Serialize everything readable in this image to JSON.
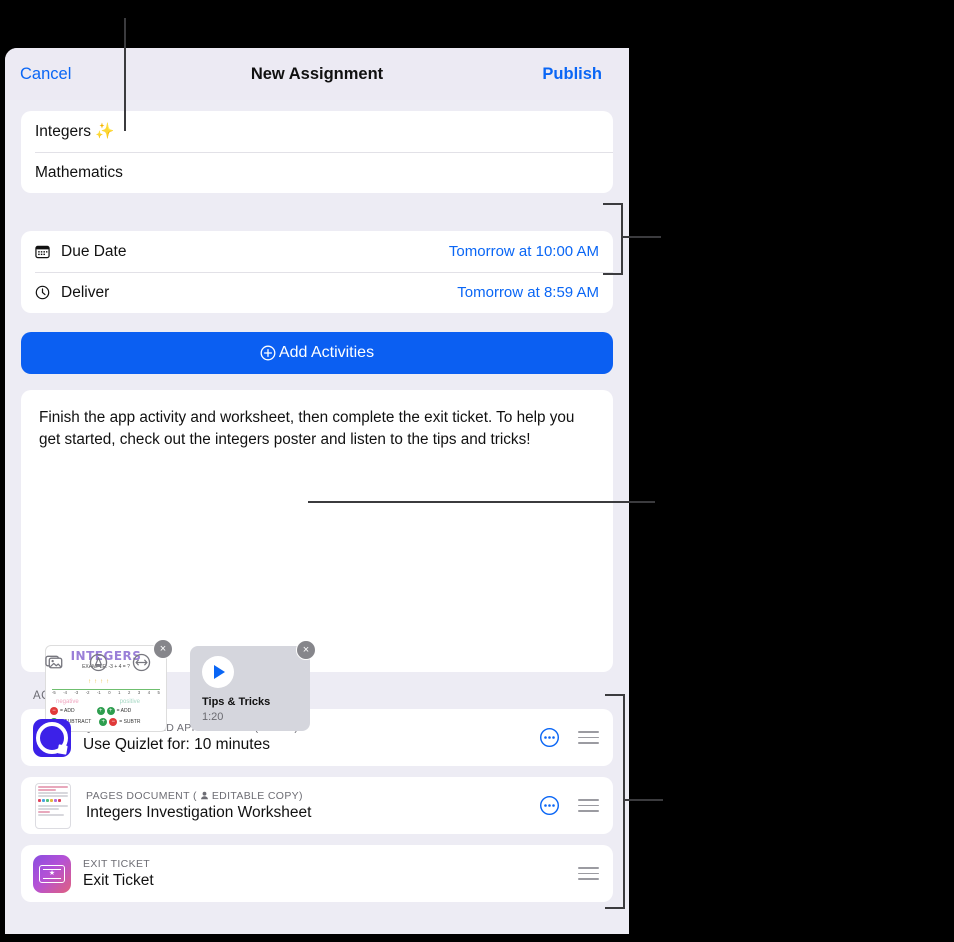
{
  "nav": {
    "cancel_label": "Cancel",
    "title": "New Assignment",
    "publish_label": "Publish"
  },
  "details": {
    "title_value": "Integers ✨",
    "subject_value": "Mathematics"
  },
  "schedule": {
    "rows": [
      {
        "icon": "calendar-icon",
        "label": "Due Date",
        "value": "Tomorrow at 10:00 AM"
      },
      {
        "icon": "clock-icon",
        "label": "Deliver",
        "value": "Tomorrow at 8:59 AM"
      }
    ]
  },
  "add_activities": {
    "label": "Add Activities",
    "icon": "plus-circle-icon"
  },
  "description": {
    "text": "Finish the app activity and worksheet, then complete the exit ticket. To help you get started, check out the integers poster and listen to the tips and tricks!",
    "attachments": [
      {
        "type": "image",
        "name": "integers-poster",
        "poster_title": "INTEGERS",
        "poster_example": "EXAMPLE: -3 + 4 = ?",
        "poster_negative_label": "negative",
        "poster_positive_label": "positive",
        "poster_number_line": [
          "-5",
          "-4",
          "-3",
          "-2",
          "-1",
          "0",
          "1",
          "2",
          "3",
          "4",
          "5"
        ],
        "poster_rows": [
          {
            "left_sign": "−",
            "left_op": "ADD",
            "right_sign_a": "+",
            "right_sign_b": "+",
            "right_op": "ADD"
          },
          {
            "left_sign": "+",
            "left_op": "SUBTRACT",
            "right_sign_a": "+",
            "right_sign_b": "−",
            "right_op": "SUBTRACT"
          }
        ],
        "delete_label": "×"
      },
      {
        "type": "video",
        "name": "tips-and-tricks-video",
        "title": "Tips & Tricks",
        "duration": "1:20",
        "delete_label": "×"
      }
    ],
    "tools": [
      {
        "name": "photo-library-icon"
      },
      {
        "name": "markup-pen-icon"
      },
      {
        "name": "audio-recording-icon"
      }
    ]
  },
  "activities": {
    "section_label": "ACTIVITIES: 3",
    "items": [
      {
        "icon": "quizlet-app-icon",
        "kicker": "QUIZLET · TIMED APP ACTIVITY (10 MIN)",
        "title": "Use Quizlet for: 10 minutes",
        "has_more": true,
        "has_grip": true,
        "editable_copy": false
      },
      {
        "icon": "pages-document-icon",
        "kicker": "PAGES DOCUMENT  (",
        "kicker_tail": "EDITABLE COPY)",
        "title": "Integers Investigation Worksheet",
        "has_more": true,
        "has_grip": true,
        "editable_copy": true
      },
      {
        "icon": "exit-ticket-icon",
        "kicker": "EXIT TICKET",
        "title": "Exit Ticket",
        "has_more": false,
        "has_grip": true,
        "editable_copy": false
      }
    ]
  },
  "colors": {
    "accent_blue": "#0a66f5",
    "button_blue": "#0b5ff2",
    "panel_bg": "#edecf4",
    "card_bg": "#ffffff",
    "backdrop": "#000000",
    "leader_line": "#3b3b3e"
  }
}
